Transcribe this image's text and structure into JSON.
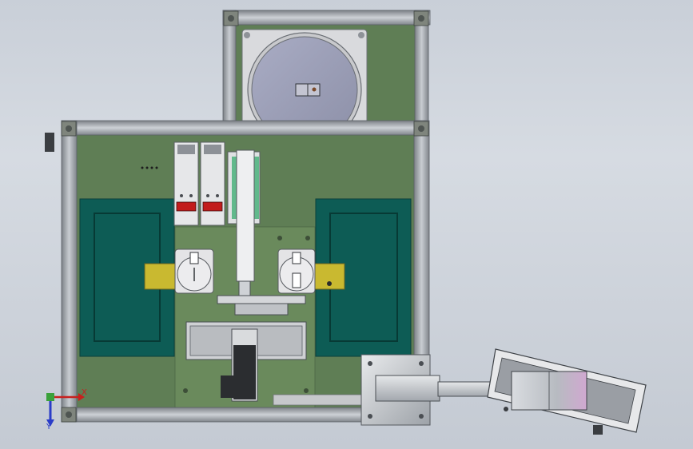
{
  "scene": {
    "background_top": "#c9cfd8",
    "background_bottom": "#c4cad3",
    "frame_color": "#a8adb3",
    "base_plate_color": "#5f7e55",
    "pad_color": "#0d5c55",
    "slide_color": "#c9b930",
    "readout_color": "#c21c1c"
  },
  "axis_triad": {
    "x_label": "X",
    "y_label": "Y",
    "x_color": "#c8201e",
    "y_color": "#2a3cc8",
    "z_color": "#3aa13a"
  }
}
